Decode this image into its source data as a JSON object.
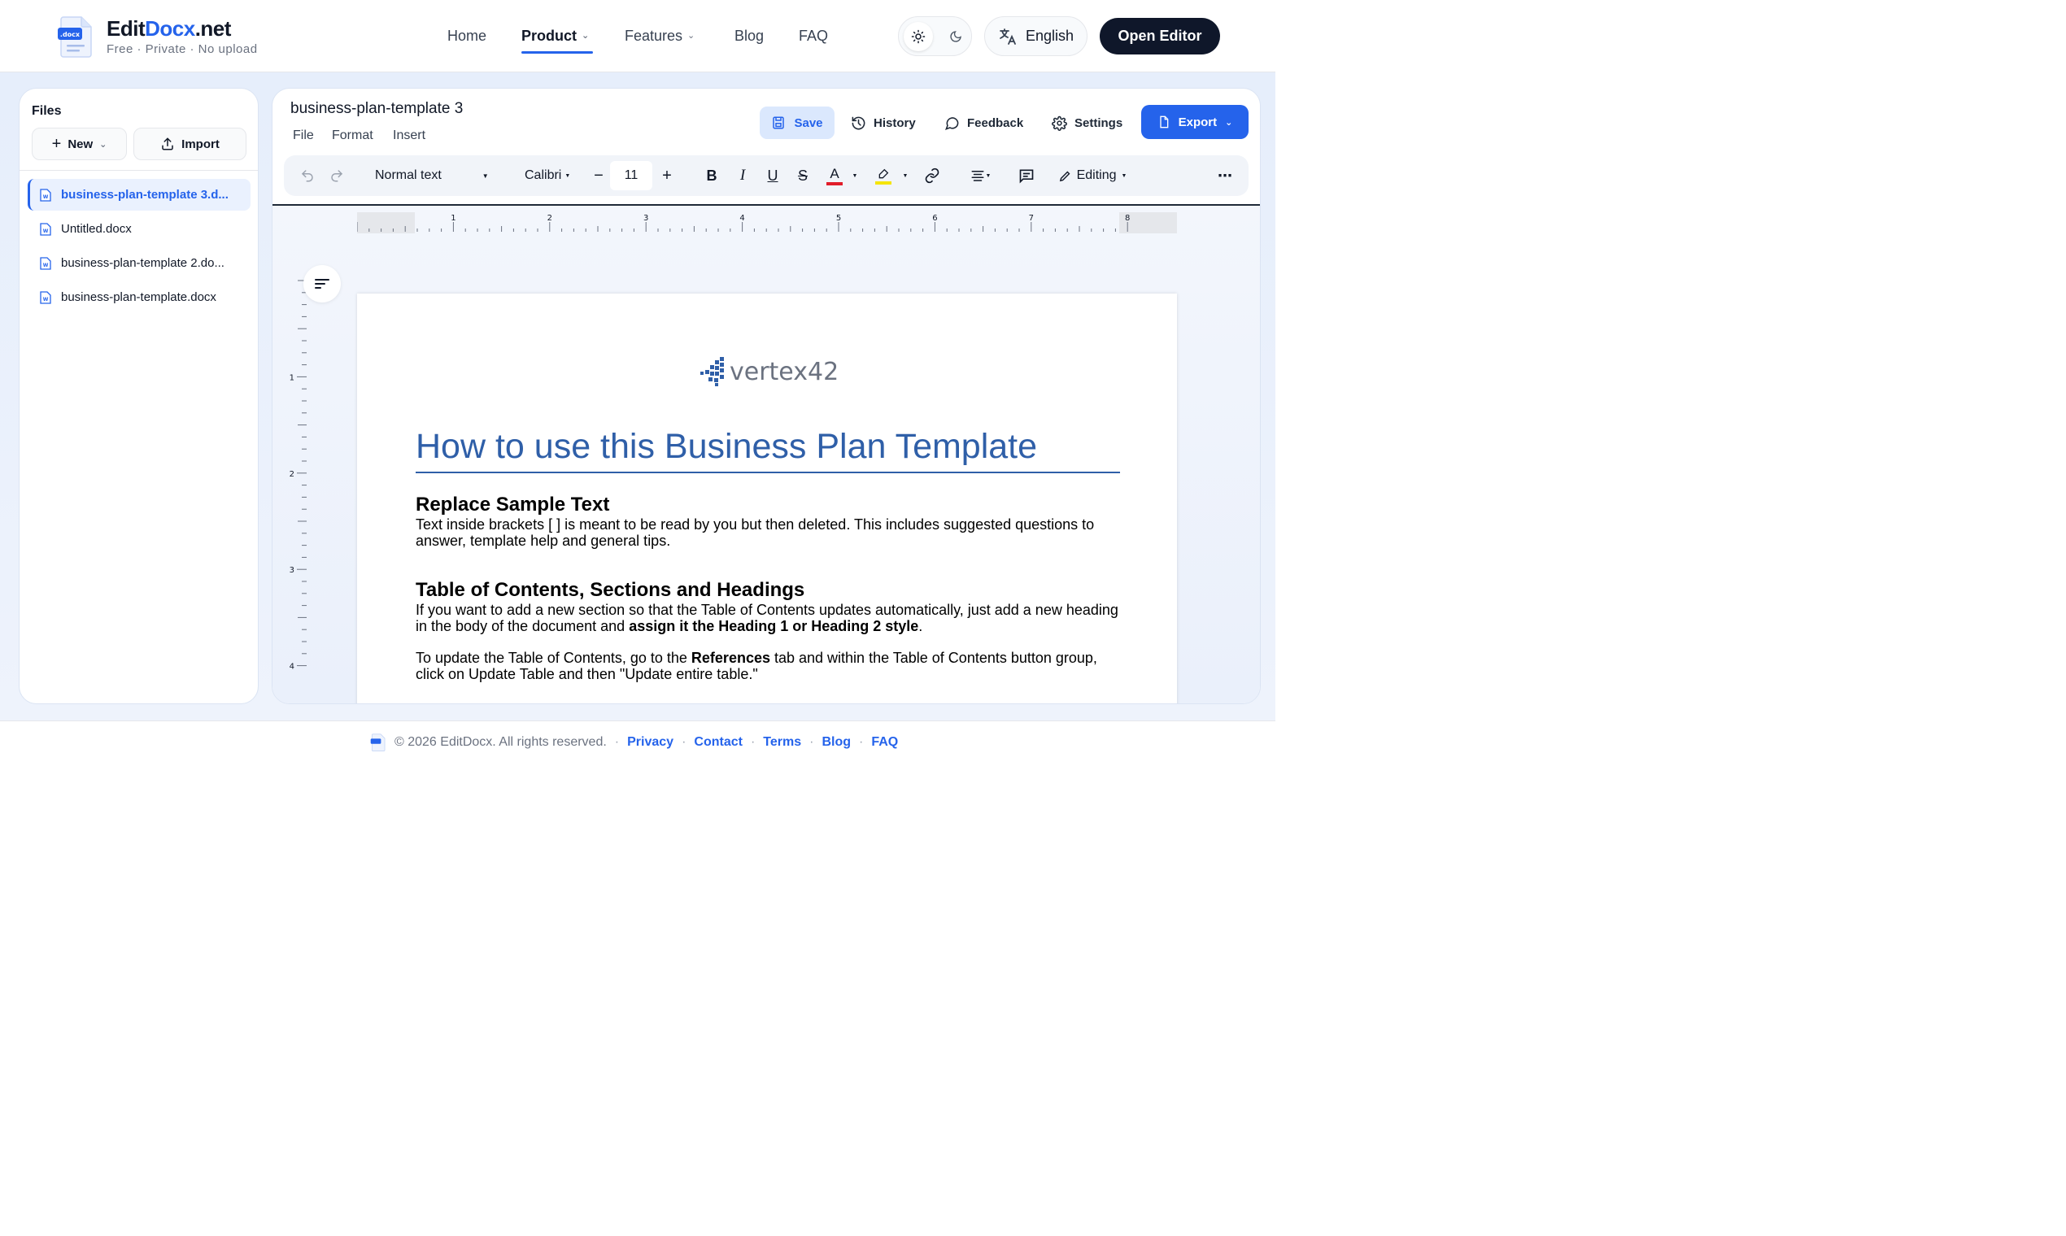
{
  "header": {
    "brand_main": "EditDocx",
    "brand_accent": ".net",
    "logo_badge": ".docx",
    "tagline": "Free · Private · No upload",
    "nav": {
      "home": "Home",
      "product": "Product",
      "features": "Features",
      "blog": "Blog",
      "faq": "FAQ"
    },
    "language": "English",
    "open_editor": "Open Editor"
  },
  "sidebar": {
    "title": "Files",
    "new_label": "New",
    "import_label": "Import",
    "files": [
      {
        "name": "business-plan-template 3.d...",
        "active": true
      },
      {
        "name": "Untitled.docx",
        "active": false
      },
      {
        "name": "business-plan-template 2.do...",
        "active": false
      },
      {
        "name": "business-plan-template.docx",
        "active": false
      }
    ]
  },
  "editor": {
    "doc_title": "business-plan-template 3",
    "menu": [
      "File",
      "Format",
      "Insert"
    ],
    "save_label": "Save",
    "history_label": "History",
    "feedback_label": "Feedback",
    "settings_label": "Settings",
    "export_label": "Export",
    "toolbar": {
      "paragraph_style": "Normal text",
      "font": "Calibri",
      "font_size": "11",
      "mode": "Editing"
    },
    "ruler_h_labels": [
      "1",
      "2",
      "3",
      "4",
      "5",
      "6",
      "7",
      "8"
    ],
    "ruler_v_labels": [
      "1",
      "2",
      "3",
      "4"
    ]
  },
  "document": {
    "logo_text": "vertex42",
    "heading": "How to use this Business Plan Template",
    "section1_title": "Replace Sample Text",
    "section1_body": "Text inside brackets [ ] is meant to be read by you but then deleted. This includes suggested questions to answer, template help and general tips.",
    "section2_title": "Table of Contents, Sections and Headings",
    "section2_body_a": "If you want to add a new section so that the Table of Contents updates automatically, just add a new heading in the body of the document and ",
    "section2_body_bold": "assign it the Heading 1 or Heading 2 style",
    "section2_body_end": ".",
    "section3_a": "To update the Table of Contents, go to the ",
    "section3_bold": "References",
    "section3_b": " tab and within the Table of Contents button group, click on Update Table and then \"Update entire table.\""
  },
  "footer": {
    "copyright": "© 2026 EditDocx. All rights reserved.",
    "links": [
      "Privacy",
      "Contact",
      "Terms",
      "Blog",
      "FAQ"
    ]
  },
  "colors": {
    "accent": "#2563eb",
    "dark_button": "#0f172a",
    "heading_blue": "#2f5fa8",
    "font_color_red": "#e11d2a",
    "highlight_yellow": "#f5e50b"
  }
}
